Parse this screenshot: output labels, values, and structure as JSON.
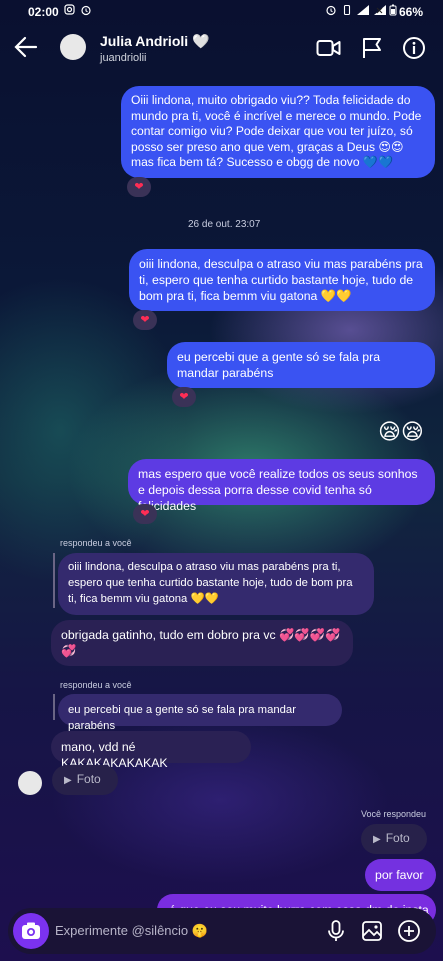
{
  "status_bar": {
    "time": "02:00",
    "battery": "66%"
  },
  "header": {
    "name": "Julia Andrioli 🤍",
    "username": "juandriolii"
  },
  "messages": {
    "m1": "Oiii lindona, muito obrigado viu?? Toda felicidade do mundo pra ti, você é incrível e merece o mundo. Pode contar comigo viu? Pode deixar que vou ter juízo, só posso ser preso ano que vem, graças a Deus 😍😍 mas fica bem tá? Sucesso e obgg de novo 💙💙",
    "timestamp": "26 de out. 23:07",
    "m2": "oiii lindona, desculpa o atraso viu mas parabéns pra ti, espero que tenha curtido bastante hoje, tudo de bom pra ti, fica bemm viu gatona 💛💛",
    "m3": "eu percebi que a gente só se fala pra mandar parabéns",
    "emojis": "😪😪",
    "m4": "mas espero que você realize todos os seus sonhos e depois dessa porra desse covid tenha só felicidades",
    "replied_label_1": "respondeu a você",
    "quoted_1": "oiii lindona, desculpa o atraso viu mas parabéns pra ti, espero que tenha curtido bastante hoje, tudo de bom pra ti, fica bemm viu gatona 💛💛",
    "r1": "obrigada gatinho, tudo em dobro pra vc 💞💞💞💞💞",
    "replied_label_2": "respondeu a você",
    "quoted_2": "eu percebi que a gente só se fala pra mandar parabéns",
    "r2": "mano,  vdd né KAKAKAKAKAKAK",
    "foto_label": "Foto",
    "you_replied": "Você respondeu",
    "foto_label_2": "Foto",
    "m5": "por favor",
    "m6": "é que eu sou muito burro com essa dm do insta"
  },
  "reaction": "❤",
  "composer": {
    "placeholder": "Experimente @silêncio 🤫"
  },
  "colors": {
    "outgoing": "#3a53f2",
    "outgoing_purple": "#5d3be3",
    "incoming": "#2a2154",
    "camera": "#7b32f0"
  }
}
